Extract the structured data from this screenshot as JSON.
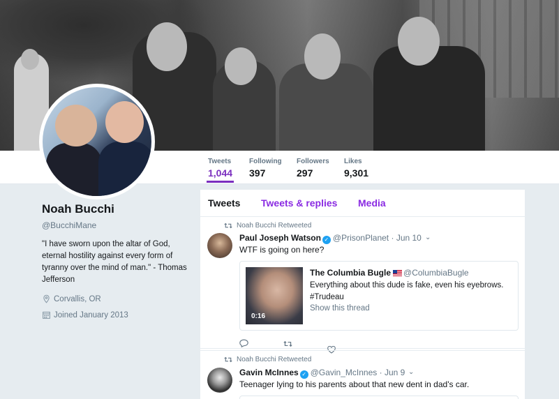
{
  "profile": {
    "name": "Noah Bucchi",
    "handle": "@BucchiMane",
    "bio": "\"I have sworn upon the altar of God, eternal hostility against every form of tyranny over the mind of man.\" - Thomas Jefferson",
    "location": "Corvallis, OR",
    "joined": "Joined January 2013"
  },
  "stats": [
    {
      "label": "Tweets",
      "value": "1,044"
    },
    {
      "label": "Following",
      "value": "397"
    },
    {
      "label": "Followers",
      "value": "297"
    },
    {
      "label": "Likes",
      "value": "9,301"
    }
  ],
  "tabs": [
    "Tweets",
    "Tweets & replies",
    "Media"
  ],
  "tweets": [
    {
      "retweet_label": "Noah Bucchi Retweeted",
      "name": "Paul Joseph Watson",
      "handle": "@PrisonPlanet",
      "date": "· Jun 10",
      "text": "WTF is going on here?",
      "quote": {
        "name": "The Columbia Bugle",
        "handle": "@ColumbiaBugle",
        "text": "Everything about this dude is fake, even his eyebrows. #Trudeau",
        "link": "Show this thread",
        "duration": "0:16"
      }
    },
    {
      "retweet_label": "Noah Bucchi Retweeted",
      "name": "Gavin McInnes",
      "handle": "@Gavin_McInnes",
      "date": "· Jun 9",
      "text": "Teenager lying to his parents about that new dent in dad's car."
    }
  ],
  "colors": {
    "accent": "#7b2fbf",
    "link": "#8a2be2",
    "muted": "#657786",
    "background": "#e6ecf0"
  },
  "icons": [
    "location-icon",
    "calendar-icon",
    "retweet-icon",
    "reply-icon",
    "like-icon",
    "verified-icon",
    "chevron-down-icon",
    "us-flag-icon"
  ]
}
